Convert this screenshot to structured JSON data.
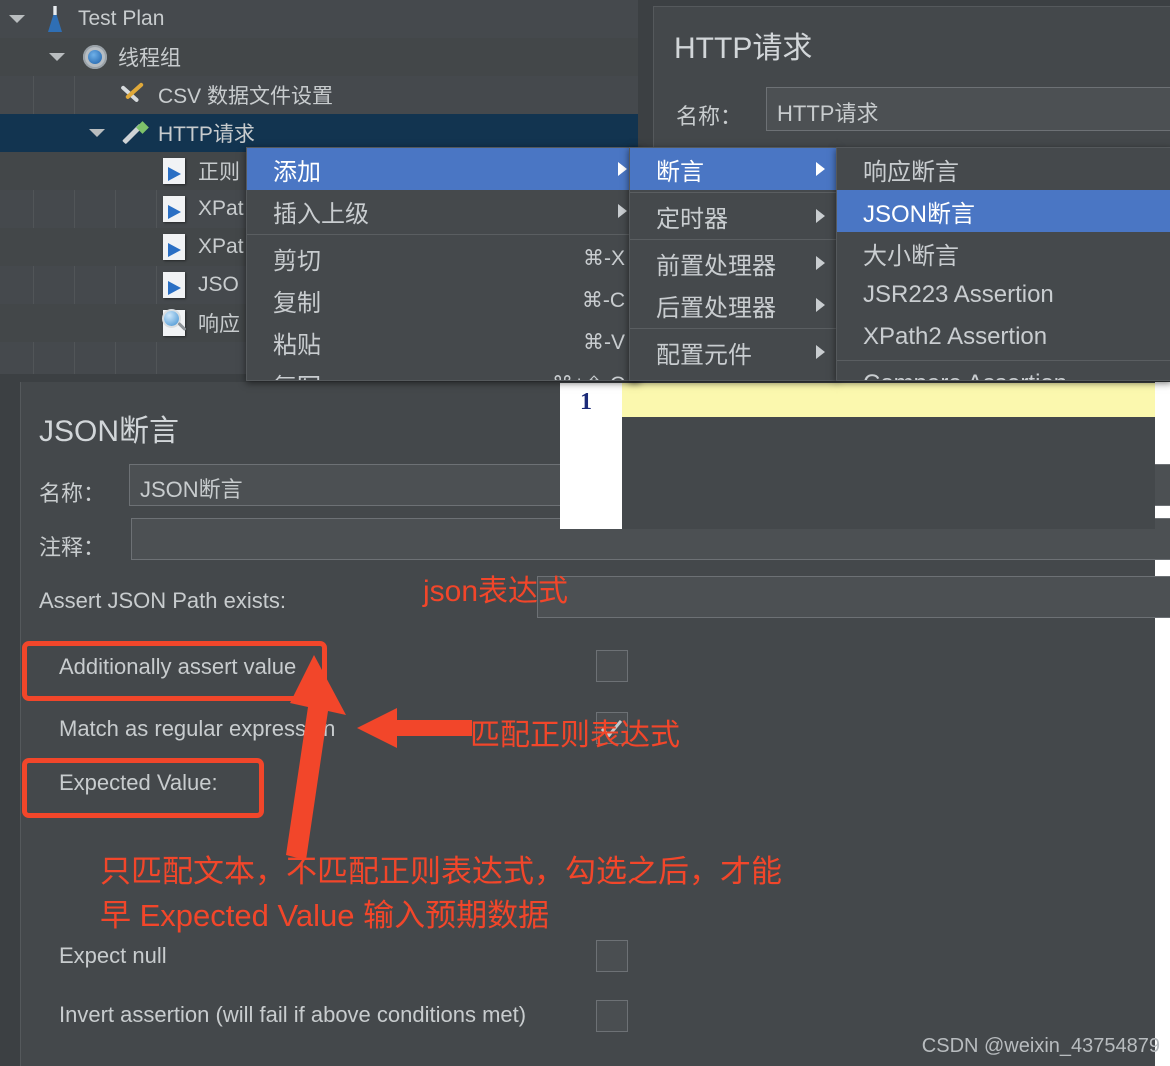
{
  "tree": {
    "items": [
      {
        "label": "Test Plan",
        "icon": "flask-icon",
        "depth": 0,
        "expanded": true,
        "selected": false
      },
      {
        "label": "线程组",
        "icon": "gear-icon",
        "depth": 1,
        "expanded": true,
        "selected": false
      },
      {
        "label": "CSV 数据文件设置",
        "icon": "tools-icon",
        "depth": 2,
        "expanded": false,
        "selected": false
      },
      {
        "label": "HTTP请求",
        "icon": "pen-icon",
        "depth": 2,
        "expanded": true,
        "selected": true
      },
      {
        "label": "正则",
        "icon": "doc-arrow-icon",
        "depth": 3,
        "expanded": false,
        "selected": false
      },
      {
        "label": "XPat",
        "icon": "doc-arrow-icon",
        "depth": 3,
        "expanded": false,
        "selected": false
      },
      {
        "label": "XPat",
        "icon": "doc-arrow-icon",
        "depth": 3,
        "expanded": false,
        "selected": false
      },
      {
        "label": "JSO",
        "icon": "doc-arrow-icon",
        "depth": 3,
        "expanded": false,
        "selected": false
      },
      {
        "label": "响应",
        "icon": "magnifier-icon",
        "depth": 3,
        "expanded": false,
        "selected": false
      }
    ]
  },
  "http_panel": {
    "title": "HTTP请求",
    "name_label": "名称：",
    "name_value": "HTTP请求"
  },
  "context_menu": {
    "items": [
      {
        "label": "添加",
        "accel": "",
        "submenu": true,
        "highlighted": true,
        "separator_after": false
      },
      {
        "label": "插入上级",
        "accel": "",
        "submenu": true,
        "highlighted": false,
        "separator_after": true
      },
      {
        "label": "剪切",
        "accel": "⌘-X",
        "submenu": false,
        "highlighted": false,
        "separator_after": false
      },
      {
        "label": "复制",
        "accel": "⌘-C",
        "submenu": false,
        "highlighted": false,
        "separator_after": false
      },
      {
        "label": "粘贴",
        "accel": "⌘-V",
        "submenu": false,
        "highlighted": false,
        "separator_after": false
      },
      {
        "label": "复写",
        "accel": "⌘+⇧-C",
        "submenu": false,
        "highlighted": false,
        "separator_after": false
      }
    ]
  },
  "submenu_add": {
    "items": [
      {
        "label": "断言",
        "submenu": true,
        "highlighted": true,
        "separator_after": true
      },
      {
        "label": "定时器",
        "submenu": true,
        "highlighted": false,
        "separator_after": true
      },
      {
        "label": "前置处理器",
        "submenu": true,
        "highlighted": false,
        "separator_after": false
      },
      {
        "label": "后置处理器",
        "submenu": true,
        "highlighted": false,
        "separator_after": true
      },
      {
        "label": "配置元件",
        "submenu": true,
        "highlighted": false,
        "separator_after": false
      }
    ]
  },
  "submenu_assertion": {
    "items": [
      {
        "label": "响应断言",
        "highlighted": false,
        "separator_after": false
      },
      {
        "label": "JSON断言",
        "highlighted": true,
        "separator_after": false
      },
      {
        "label": "大小断言",
        "highlighted": false,
        "separator_after": false
      },
      {
        "label": "JSR223 Assertion",
        "highlighted": false,
        "separator_after": false
      },
      {
        "label": "XPath2 Assertion",
        "highlighted": false,
        "separator_after": true
      },
      {
        "label": "Compare Assertion",
        "highlighted": false,
        "separator_after": false
      }
    ]
  },
  "assertion_panel": {
    "title": "JSON断言",
    "name_label": "名称：",
    "name_value": "JSON断言",
    "note_label": "注释：",
    "note_value": "",
    "json_path_label": "Assert JSON Path exists:",
    "json_path_value": "",
    "additionally_assert_value_label": "Additionally assert value",
    "additionally_assert_value_checked": false,
    "match_regex_label": "Match as regular expression",
    "match_regex_checked": true,
    "expected_value_label": "Expected Value:",
    "expected_value_line_number": "1",
    "expected_value_text": "",
    "expect_null_label": "Expect null",
    "expect_null_checked": false,
    "invert_label": "Invert assertion (will fail if above conditions met)",
    "invert_checked": false
  },
  "annotations": {
    "json_expression": "json表达式",
    "match_regex_note": "匹配正则表达式",
    "note_line1": "只匹配文本，不匹配正则表达式，勾选之后，才能",
    "note_line2": "早 Expected Value 输入预期数据",
    "accent_color": "#f2462a"
  },
  "watermark": "CSDN @weixin_43754879"
}
